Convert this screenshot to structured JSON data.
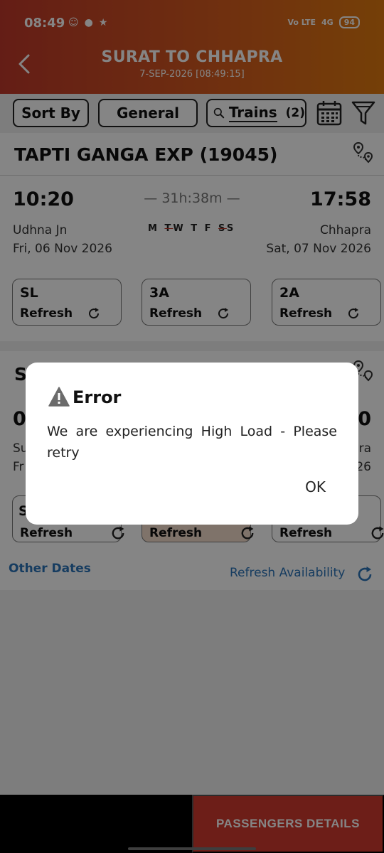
{
  "status_bar": {
    "time": "08:49",
    "network": "4G",
    "lte": "Vo LTE",
    "battery": "94"
  },
  "header": {
    "title": "SURAT TO CHHAPRA",
    "subtitle": "7-SEP-2026 [08:49:15]"
  },
  "filters": {
    "sort_label": "Sort By",
    "general_label": "General",
    "trains_label": "Trains",
    "trains_count": "(2)"
  },
  "train1": {
    "name": "TAPTI GANGA EXP (19045)",
    "dep_time": "10:20",
    "arr_time": "17:58",
    "duration": "— 31h:38m —",
    "days": "MTWTFSS",
    "from_station": "Udhna Jn",
    "from_date": "Fri, 06 Nov 2026",
    "to_station": "Chhapra",
    "to_date": "Sat, 07 Nov 2026",
    "classes": [
      {
        "code": "SL",
        "refresh": "Refresh"
      },
      {
        "code": "3A",
        "refresh": "Refresh"
      },
      {
        "code": "2A",
        "refresh": "Refresh"
      }
    ]
  },
  "train2": {
    "name_partial": "S",
    "dep_partial": "0",
    "arr_partial": "0",
    "from_partial": "Su",
    "from_date_partial": "Fr",
    "to_partial": "ra",
    "to_date_partial": "26",
    "class_partial": "S",
    "classes": [
      {
        "refresh": "Refresh"
      },
      {
        "refresh": "Refresh"
      },
      {
        "refresh": "Refresh"
      }
    ],
    "other_dates": "Other Dates",
    "refresh_availability": "Refresh Availability"
  },
  "bottom": {
    "passengers_button": "PASSENGERS DETAILS"
  },
  "dialog": {
    "title": "Error",
    "message": "We are experiencing High Load - Please retry",
    "ok": "OK"
  },
  "colors": {
    "header_start": "#c0392b",
    "header_end": "#e07a10",
    "link_blue": "#2b74b8",
    "bottom_button": "#d23a2f"
  }
}
